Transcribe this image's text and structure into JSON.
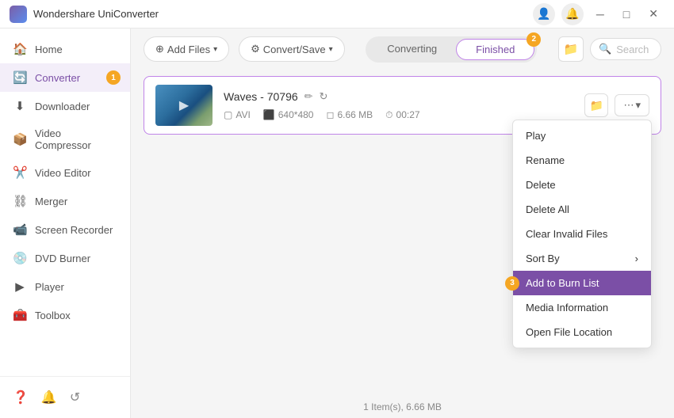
{
  "app": {
    "title": "Wondershare UniConverter",
    "logo_color": "#7b5ea7"
  },
  "title_bar": {
    "title": "Wondershare UniConverter"
  },
  "sidebar": {
    "items": [
      {
        "id": "home",
        "label": "Home",
        "icon": "🏠",
        "active": false
      },
      {
        "id": "converter",
        "label": "Converter",
        "icon": "🔄",
        "active": true,
        "badge": "1"
      },
      {
        "id": "downloader",
        "label": "Downloader",
        "icon": "⬇️",
        "active": false
      },
      {
        "id": "video-compressor",
        "label": "Video Compressor",
        "icon": "📦",
        "active": false
      },
      {
        "id": "video-editor",
        "label": "Video Editor",
        "icon": "✂️",
        "active": false
      },
      {
        "id": "merger",
        "label": "Merger",
        "icon": "🔗",
        "active": false
      },
      {
        "id": "screen-recorder",
        "label": "Screen Recorder",
        "icon": "📹",
        "active": false
      },
      {
        "id": "dvd-burner",
        "label": "DVD Burner",
        "icon": "💿",
        "active": false
      },
      {
        "id": "player",
        "label": "Player",
        "icon": "▶️",
        "active": false
      },
      {
        "id": "toolbox",
        "label": "Toolbox",
        "icon": "🧰",
        "active": false
      }
    ],
    "bottom_icons": [
      "❓",
      "🔔",
      "↺"
    ]
  },
  "toolbar": {
    "add_btn": "Add Files",
    "convert_btn": "Convert/Save",
    "search_placeholder": "Search"
  },
  "tabs": {
    "converting": "Converting",
    "finished": "Finished",
    "active": "finished",
    "badge": "2"
  },
  "file": {
    "name": "Waves - 70796",
    "format": "AVI",
    "resolution": "640*480",
    "size": "6.66 MB",
    "duration": "00:27"
  },
  "context_menu": {
    "items": [
      {
        "id": "play",
        "label": "Play",
        "highlighted": false
      },
      {
        "id": "rename",
        "label": "Rename",
        "highlighted": false
      },
      {
        "id": "delete",
        "label": "Delete",
        "highlighted": false
      },
      {
        "id": "delete-all",
        "label": "Delete All",
        "highlighted": false
      },
      {
        "id": "clear-invalid",
        "label": "Clear Invalid Files",
        "highlighted": false
      },
      {
        "id": "sort-by",
        "label": "Sort By",
        "highlighted": false,
        "has_arrow": true
      },
      {
        "id": "add-to-burn",
        "label": "Add to Burn List",
        "highlighted": true
      },
      {
        "id": "media-info",
        "label": "Media Information",
        "highlighted": false
      },
      {
        "id": "open-location",
        "label": "Open File Location",
        "highlighted": false
      }
    ],
    "badge_number": "3"
  },
  "status_bar": {
    "text": "1 Item(s), 6.66 MB"
  }
}
